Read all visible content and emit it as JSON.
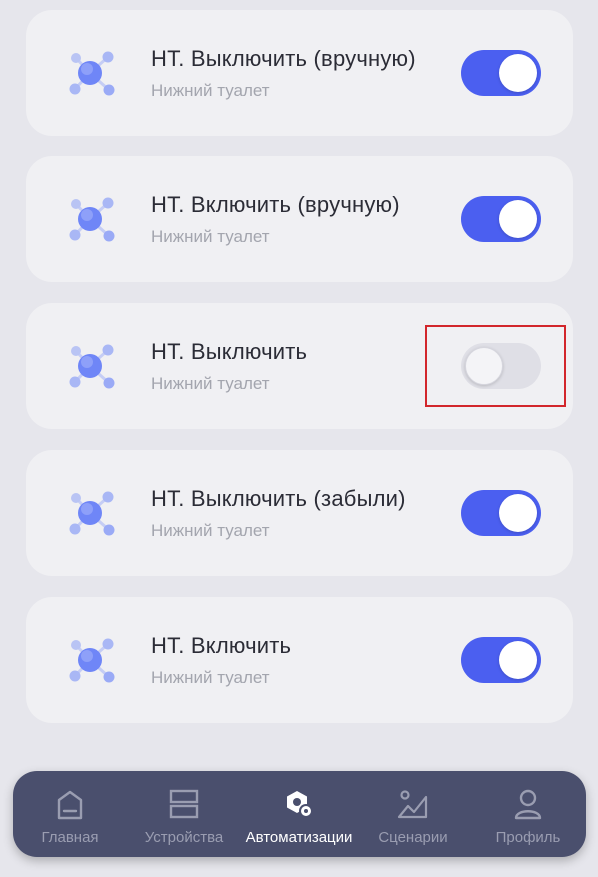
{
  "automations": [
    {
      "title": "НТ. Выключить (вручную)",
      "subtitle": "Нижний туалет",
      "enabled": true
    },
    {
      "title": "НТ. Включить (вручную)",
      "subtitle": "Нижний туалет",
      "enabled": true
    },
    {
      "title": "НТ. Выключить",
      "subtitle": "Нижний туалет",
      "enabled": false
    },
    {
      "title": "НТ. Выключить (забыли)",
      "subtitle": "Нижний туалет",
      "enabled": true
    },
    {
      "title": "НТ. Включить",
      "subtitle": "Нижний туалет",
      "enabled": true
    }
  ],
  "nav": {
    "items": [
      {
        "label": "Главная",
        "icon": "home-icon",
        "active": false
      },
      {
        "label": "Устройства",
        "icon": "devices-icon",
        "active": false
      },
      {
        "label": "Автоматизации",
        "icon": "automation-icon",
        "active": true
      },
      {
        "label": "Сценарии",
        "icon": "scenes-icon",
        "active": false
      },
      {
        "label": "Профиль",
        "icon": "profile-icon",
        "active": false
      }
    ]
  },
  "colors": {
    "toggle_on": "#4b5ff0",
    "toggle_off": "#dfdfe6",
    "highlight": "#d2262b",
    "nav_bg": "#4a4f6d"
  }
}
